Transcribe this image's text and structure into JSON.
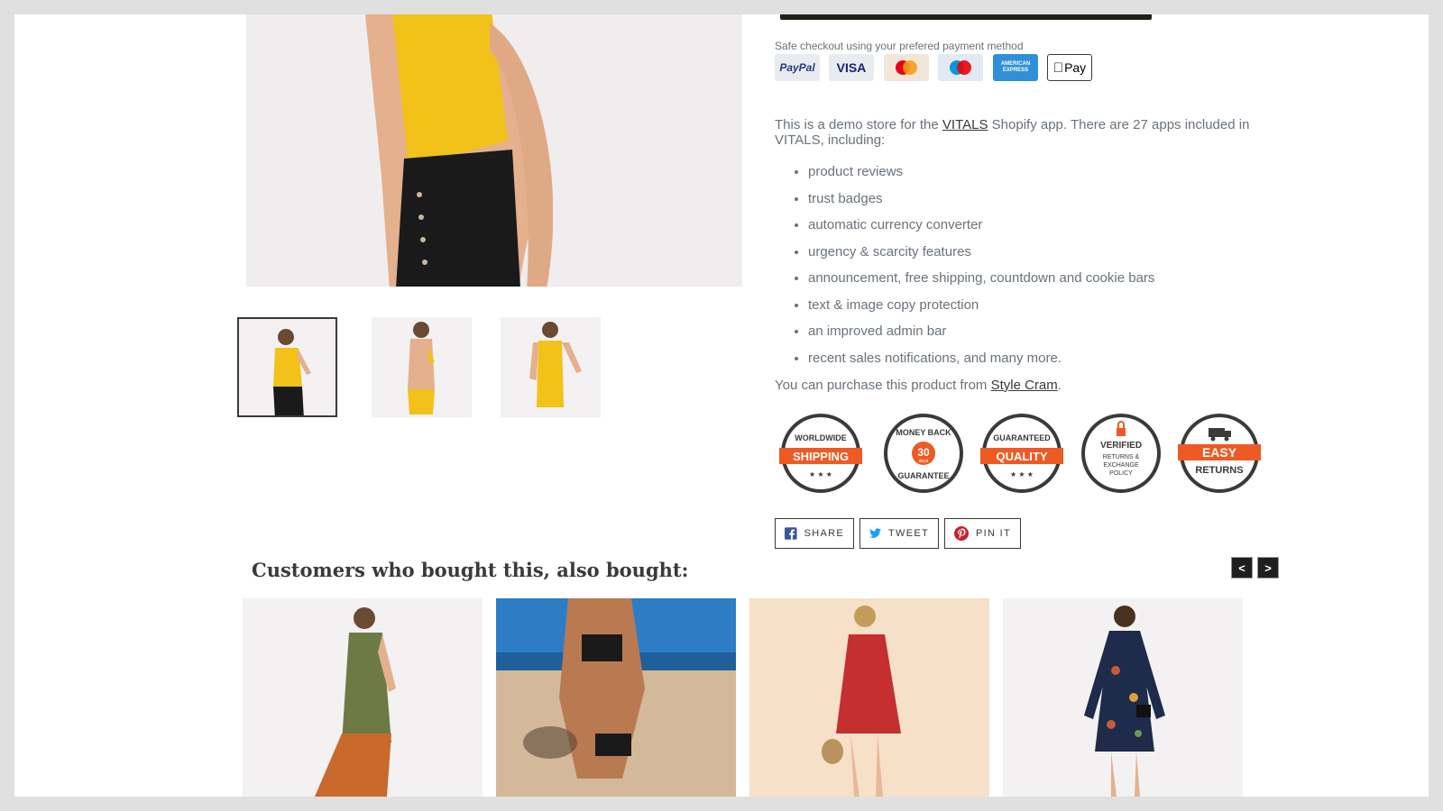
{
  "payment": {
    "caption": "Safe checkout using your prefered payment method",
    "methods": [
      "PayPal",
      "VISA",
      "MasterCard",
      "Maestro",
      "AMERICAN EXPRESS",
      "Pay"
    ]
  },
  "description": {
    "intro_before": "This is a demo store for the ",
    "vitals_link": "VITALS",
    "intro_after": " Shopify app. There are 27 apps included in VITALS, including:",
    "features": [
      "product reviews",
      "trust badges",
      "automatic currency converter",
      "urgency & scarcity features",
      "announcement, free shipping, countdown and cookie bars",
      "text & image copy protection",
      "an improved admin bar",
      "recent sales notifications, and many more."
    ],
    "purchase_before": "You can purchase this product from ",
    "purchase_link": "Style Cram",
    "purchase_after": "."
  },
  "badges": [
    {
      "top": "WORLDWIDE",
      "ribbon": "SHIPPING",
      "bottom": ""
    },
    {
      "top": "MONEY BACK",
      "center": "30",
      "sub": "days",
      "bottom": "GUARANTEE"
    },
    {
      "top": "GUARANTEED",
      "ribbon": "QUALITY",
      "bottom": ""
    },
    {
      "top": "VERIFIED",
      "lines": [
        "RETURNS &",
        "EXCHANGE",
        "POLICY"
      ]
    },
    {
      "ribbon": "EASY",
      "bottom": "RETURNS"
    }
  ],
  "social": {
    "share": "SHARE",
    "tweet": "TWEET",
    "pin": "PIN IT"
  },
  "related": {
    "title": "Customers who bought this, also bought:",
    "prev": "<",
    "next": ">"
  },
  "colors": {
    "accent_orange": "#ee5a24",
    "dark": "#3a3a3a",
    "text": "#69727b"
  }
}
